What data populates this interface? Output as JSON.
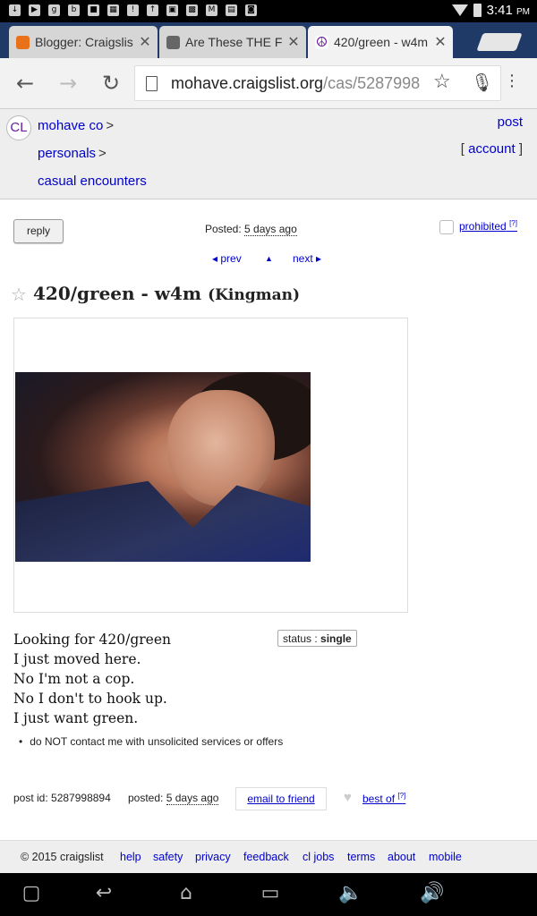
{
  "status_bar": {
    "time": "3:41",
    "ampm": "PM"
  },
  "tabs": [
    {
      "label": "Blogger: Craigslis",
      "favicon_color": "#e8711a"
    },
    {
      "label": "Are These THE F",
      "favicon_color": "#666666"
    },
    {
      "label": "420/green - w4m",
      "favicon_color": "#6a1b9a"
    }
  ],
  "omnibox": {
    "host": "mohave.craigslist.org",
    "path": "/cas/5287998"
  },
  "cl_header": {
    "logo": "CL",
    "breadcrumbs": [
      "mohave co",
      "personals",
      "casual encounters"
    ],
    "separator": ">",
    "post": "post",
    "account_open": "[",
    "account": "account",
    "account_close": "]"
  },
  "post": {
    "reply": "reply",
    "posted_label": "Posted:",
    "posted_value": "5 days ago",
    "prohibited": "prohibited",
    "help_mark": "[?]",
    "prev": "◂ prev",
    "up": "▲",
    "next": "next ▸",
    "title": "420/green - w4m",
    "location": "(Kingman)",
    "body_lines": [
      "Looking for 420/green",
      "I just moved here.",
      "No I'm not a cop.",
      "No I don't to hook up.",
      "I just want green."
    ],
    "status_label": "status :",
    "status_value": "single",
    "notice": "do NOT contact me with unsolicited services or offers",
    "post_id": "post id: 5287998894",
    "posted_foot_label": "posted:",
    "posted_foot_value": "5 days ago",
    "email_friend": "email to friend",
    "best_of": "best of"
  },
  "footer": {
    "copyright": "© 2015 craigslist",
    "links": [
      "help",
      "safety",
      "privacy",
      "feedback",
      "cl jobs",
      "terms",
      "about",
      "mobile"
    ]
  },
  "colors": {
    "link": "#0000cc",
    "tab_strip": "#1f3a67",
    "status_bar": "#000000"
  }
}
